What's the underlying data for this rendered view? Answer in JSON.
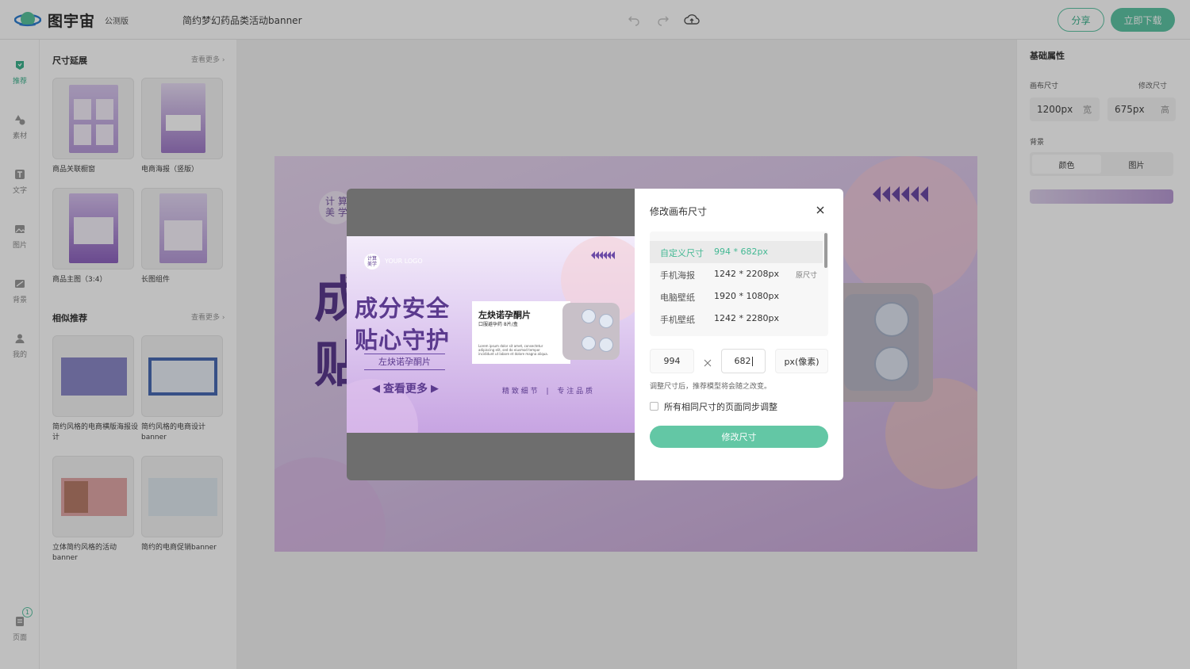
{
  "header": {
    "logo_text": "图宇宙",
    "beta_label": "公测版",
    "doc_title": "简约梦幻药品类活动banner",
    "share_label": "分享",
    "download_label": "立即下载"
  },
  "rail": {
    "items": [
      {
        "label": "推荐",
        "icon": "recommend-icon"
      },
      {
        "label": "素材",
        "icon": "shapes-icon"
      },
      {
        "label": "文字",
        "icon": "text-icon"
      },
      {
        "label": "图片",
        "icon": "image-icon"
      },
      {
        "label": "背景",
        "icon": "background-icon"
      },
      {
        "label": "我的",
        "icon": "user-icon"
      }
    ],
    "pages_label": "页面",
    "pages_count": "1"
  },
  "panel": {
    "section1_title": "尺寸延展",
    "section1_more": "查看更多",
    "section1_items": [
      "商品关联橱窗",
      "电商海报（竖版）",
      "商品主图（3:4）",
      "长图组件"
    ],
    "section2_title": "相似推荐",
    "section2_more": "查看更多",
    "section2_items": [
      "简约风格的电商横版海报设计",
      "简约风格的电商设计banner",
      "立体简约风格的活动banner",
      "简约的电商促销banner"
    ]
  },
  "props": {
    "title": "基础属性",
    "canvas_size_label": "画布尺寸",
    "modify_size_label": "修改尺寸",
    "width_value": "1200px",
    "width_unit": "宽",
    "height_value": "675px",
    "height_unit": "高",
    "background_label": "背景",
    "bg_color_tab": "颜色",
    "bg_image_tab": "图片"
  },
  "canvas": {
    "logo_text": "计 算\n美 学",
    "headline_1": "成",
    "headline_2": "贴"
  },
  "dialog": {
    "title": "修改画布尺寸",
    "sizes": [
      {
        "name": "自定义尺寸",
        "value": "994 * 682px",
        "tag": ""
      },
      {
        "name": "手机海报",
        "value": "1242 * 2208px",
        "tag": "原尺寸"
      },
      {
        "name": "电脑壁纸",
        "value": "1920 * 1080px",
        "tag": ""
      },
      {
        "name": "手机壁纸",
        "value": "1242 * 2280px",
        "tag": ""
      }
    ],
    "width_input": "994",
    "height_input": "682",
    "unit_label": "px(像素)",
    "hint": "调整尺寸后，推荐模型将会随之改变。",
    "sync_label": "所有相同尺寸的页面同步调整",
    "submit_label": "修改尺寸"
  },
  "preview": {
    "logo_badge": "计算\n美学",
    "logo_text": "YOUR LOGO",
    "headline_1": "成分安全",
    "headline_2": "贴心守护",
    "sub": "左炔诺孕酮片",
    "cta": "查看更多",
    "card_title": "左炔诺孕酮片",
    "card_sub": "口服避孕药   8片/盒",
    "card_body": "Lorem ipsum dolor sit amet, consectetur adipiscing elit, sed do eiusmod tempor incididunt ut labore et dolore magna aliqua.",
    "tagline_1": "精 致 细 节",
    "tagline_sep": "|",
    "tagline_2": "专 注 品 质"
  },
  "colors": {
    "accent": "#5ec4a4",
    "accent_text": "#3eb28e",
    "purple_dark": "#5b3a8e",
    "purple_mid": "#7a4fa8"
  }
}
